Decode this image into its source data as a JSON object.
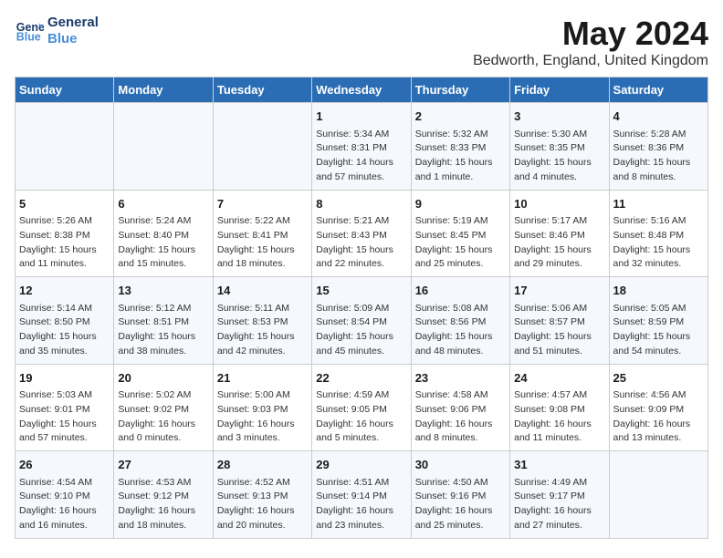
{
  "header": {
    "logo_line1": "General",
    "logo_line2": "Blue",
    "title": "May 2024",
    "subtitle": "Bedworth, England, United Kingdom"
  },
  "days_of_week": [
    "Sunday",
    "Monday",
    "Tuesday",
    "Wednesday",
    "Thursday",
    "Friday",
    "Saturday"
  ],
  "weeks": [
    [
      {
        "day": "",
        "info": ""
      },
      {
        "day": "",
        "info": ""
      },
      {
        "day": "",
        "info": ""
      },
      {
        "day": "1",
        "info": "Sunrise: 5:34 AM\nSunset: 8:31 PM\nDaylight: 14 hours\nand 57 minutes."
      },
      {
        "day": "2",
        "info": "Sunrise: 5:32 AM\nSunset: 8:33 PM\nDaylight: 15 hours\nand 1 minute."
      },
      {
        "day": "3",
        "info": "Sunrise: 5:30 AM\nSunset: 8:35 PM\nDaylight: 15 hours\nand 4 minutes."
      },
      {
        "day": "4",
        "info": "Sunrise: 5:28 AM\nSunset: 8:36 PM\nDaylight: 15 hours\nand 8 minutes."
      }
    ],
    [
      {
        "day": "5",
        "info": "Sunrise: 5:26 AM\nSunset: 8:38 PM\nDaylight: 15 hours\nand 11 minutes."
      },
      {
        "day": "6",
        "info": "Sunrise: 5:24 AM\nSunset: 8:40 PM\nDaylight: 15 hours\nand 15 minutes."
      },
      {
        "day": "7",
        "info": "Sunrise: 5:22 AM\nSunset: 8:41 PM\nDaylight: 15 hours\nand 18 minutes."
      },
      {
        "day": "8",
        "info": "Sunrise: 5:21 AM\nSunset: 8:43 PM\nDaylight: 15 hours\nand 22 minutes."
      },
      {
        "day": "9",
        "info": "Sunrise: 5:19 AM\nSunset: 8:45 PM\nDaylight: 15 hours\nand 25 minutes."
      },
      {
        "day": "10",
        "info": "Sunrise: 5:17 AM\nSunset: 8:46 PM\nDaylight: 15 hours\nand 29 minutes."
      },
      {
        "day": "11",
        "info": "Sunrise: 5:16 AM\nSunset: 8:48 PM\nDaylight: 15 hours\nand 32 minutes."
      }
    ],
    [
      {
        "day": "12",
        "info": "Sunrise: 5:14 AM\nSunset: 8:50 PM\nDaylight: 15 hours\nand 35 minutes."
      },
      {
        "day": "13",
        "info": "Sunrise: 5:12 AM\nSunset: 8:51 PM\nDaylight: 15 hours\nand 38 minutes."
      },
      {
        "day": "14",
        "info": "Sunrise: 5:11 AM\nSunset: 8:53 PM\nDaylight: 15 hours\nand 42 minutes."
      },
      {
        "day": "15",
        "info": "Sunrise: 5:09 AM\nSunset: 8:54 PM\nDaylight: 15 hours\nand 45 minutes."
      },
      {
        "day": "16",
        "info": "Sunrise: 5:08 AM\nSunset: 8:56 PM\nDaylight: 15 hours\nand 48 minutes."
      },
      {
        "day": "17",
        "info": "Sunrise: 5:06 AM\nSunset: 8:57 PM\nDaylight: 15 hours\nand 51 minutes."
      },
      {
        "day": "18",
        "info": "Sunrise: 5:05 AM\nSunset: 8:59 PM\nDaylight: 15 hours\nand 54 minutes."
      }
    ],
    [
      {
        "day": "19",
        "info": "Sunrise: 5:03 AM\nSunset: 9:01 PM\nDaylight: 15 hours\nand 57 minutes."
      },
      {
        "day": "20",
        "info": "Sunrise: 5:02 AM\nSunset: 9:02 PM\nDaylight: 16 hours\nand 0 minutes."
      },
      {
        "day": "21",
        "info": "Sunrise: 5:00 AM\nSunset: 9:03 PM\nDaylight: 16 hours\nand 3 minutes."
      },
      {
        "day": "22",
        "info": "Sunrise: 4:59 AM\nSunset: 9:05 PM\nDaylight: 16 hours\nand 5 minutes."
      },
      {
        "day": "23",
        "info": "Sunrise: 4:58 AM\nSunset: 9:06 PM\nDaylight: 16 hours\nand 8 minutes."
      },
      {
        "day": "24",
        "info": "Sunrise: 4:57 AM\nSunset: 9:08 PM\nDaylight: 16 hours\nand 11 minutes."
      },
      {
        "day": "25",
        "info": "Sunrise: 4:56 AM\nSunset: 9:09 PM\nDaylight: 16 hours\nand 13 minutes."
      }
    ],
    [
      {
        "day": "26",
        "info": "Sunrise: 4:54 AM\nSunset: 9:10 PM\nDaylight: 16 hours\nand 16 minutes."
      },
      {
        "day": "27",
        "info": "Sunrise: 4:53 AM\nSunset: 9:12 PM\nDaylight: 16 hours\nand 18 minutes."
      },
      {
        "day": "28",
        "info": "Sunrise: 4:52 AM\nSunset: 9:13 PM\nDaylight: 16 hours\nand 20 minutes."
      },
      {
        "day": "29",
        "info": "Sunrise: 4:51 AM\nSunset: 9:14 PM\nDaylight: 16 hours\nand 23 minutes."
      },
      {
        "day": "30",
        "info": "Sunrise: 4:50 AM\nSunset: 9:16 PM\nDaylight: 16 hours\nand 25 minutes."
      },
      {
        "day": "31",
        "info": "Sunrise: 4:49 AM\nSunset: 9:17 PM\nDaylight: 16 hours\nand 27 minutes."
      },
      {
        "day": "",
        "info": ""
      }
    ]
  ]
}
